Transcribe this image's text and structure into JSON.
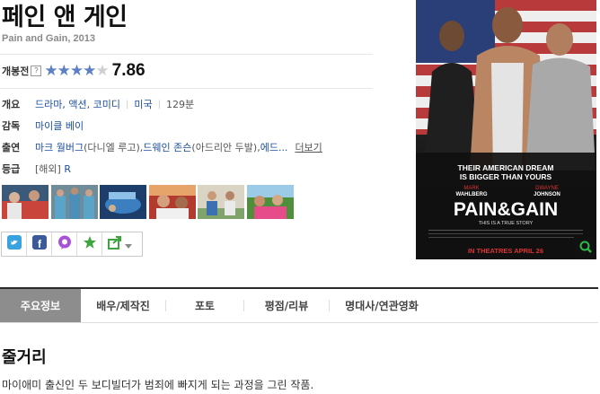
{
  "movie": {
    "title": "페인 앤 게인",
    "subtitle": "Pain and Gain, 2013"
  },
  "rating": {
    "label": "개봉전",
    "help": "?",
    "stars_filled": 4,
    "stars_total": 5,
    "score": "7.86",
    "star_color": "#5d7fc3"
  },
  "info": {
    "overview": {
      "label": "개요",
      "genres": [
        "드라마",
        "액션",
        "코미디"
      ],
      "country": "미국",
      "runtime": "129분"
    },
    "director": {
      "label": "감독",
      "name": "마이클 베이"
    },
    "cast": {
      "label": "출연",
      "actor1": "마크 월버그",
      "role1": "(다니엘 루고), ",
      "actor2": "드웨인 존슨",
      "role2": "(아드리안 두발), ",
      "actor3": "에드...",
      "more": "더보기"
    },
    "grade": {
      "label": "등급",
      "value": "[해외]",
      "code": "R"
    }
  },
  "stills": [
    {
      "name": "still-1"
    },
    {
      "name": "still-2"
    },
    {
      "name": "still-3"
    },
    {
      "name": "still-4"
    },
    {
      "name": "still-5"
    },
    {
      "name": "still-6"
    }
  ],
  "share": {
    "icons": [
      "twitter-icon",
      "facebook-icon",
      "talk-icon",
      "star-icon",
      "share-icon"
    ]
  },
  "poster": {
    "tagline1": "THEIR AMERICAN DREAM",
    "tagline2": "IS BIGGER THAN YOURS",
    "cast1": "MARK",
    "cast1b": "WAHLBERG",
    "cast2": "DWAYNE",
    "cast2b": "JOHNSON",
    "title": "PAIN&GAIN",
    "subline": "THIS IS A TRUE STORY",
    "release": "IN THEATRES  APRIL 26"
  },
  "tabs": [
    "주요정보",
    "배우/제작진",
    "포토",
    "평점/리뷰",
    "명대사/연관영화"
  ],
  "synopsis": {
    "heading": "줄거리",
    "text": "마이애미 출신인 두 보디빌더가 범죄에 빠지게 되는 과정을 그린 작품."
  },
  "colors": {
    "link": "#1b4e9b",
    "tab_active_bg": "#8d8d8d",
    "star_empty": "#cfcfcf"
  }
}
